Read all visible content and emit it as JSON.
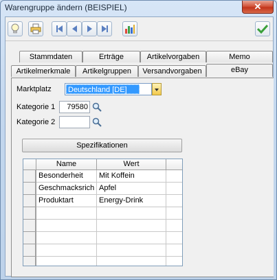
{
  "window": {
    "title": "Warengruppe ändern (BEISPIEL)",
    "close_glyph": "✕"
  },
  "toolbar": {
    "buttons": [
      {
        "name": "lightbulb-icon"
      },
      {
        "name": "print-icon"
      },
      {
        "name": "first-record-icon"
      },
      {
        "name": "previous-record-icon"
      },
      {
        "name": "next-record-icon"
      },
      {
        "name": "last-record-icon"
      },
      {
        "name": "chart-icon"
      },
      {
        "name": "checkmark-icon"
      }
    ]
  },
  "tabs": {
    "row_top": [
      "Stammdaten",
      "Erträge",
      "Artikelvorgaben",
      "Memo"
    ],
    "row_bottom": [
      "Artikelmerkmale",
      "Artikelgruppen",
      "Versandvorgaben",
      "eBay"
    ],
    "active": "eBay"
  },
  "ebay": {
    "marktplatz_label": "Marktplatz",
    "marktplatz_value": "Deutschland [DE]",
    "kategorie1_label": "Kategorie 1",
    "kategorie1_value": "79580",
    "kategorie2_label": "Kategorie 2",
    "kategorie2_value": "",
    "spezifikationen_button": "Spezifikationen",
    "grid": {
      "columns": [
        "Name",
        "Wert"
      ],
      "rows": [
        [
          "Besonderheit",
          "Mit Koffein"
        ],
        [
          "Geschmacksrich",
          "Apfel"
        ],
        [
          "Produktart",
          "Energy-Drink"
        ],
        [
          "",
          ""
        ],
        [
          "",
          ""
        ],
        [
          "",
          ""
        ],
        [
          "",
          ""
        ],
        [
          "",
          ""
        ]
      ]
    }
  },
  "colors": {
    "selection": "#3399ff",
    "window_frame": "#c3d7ee",
    "close_button": "#c2341a"
  }
}
